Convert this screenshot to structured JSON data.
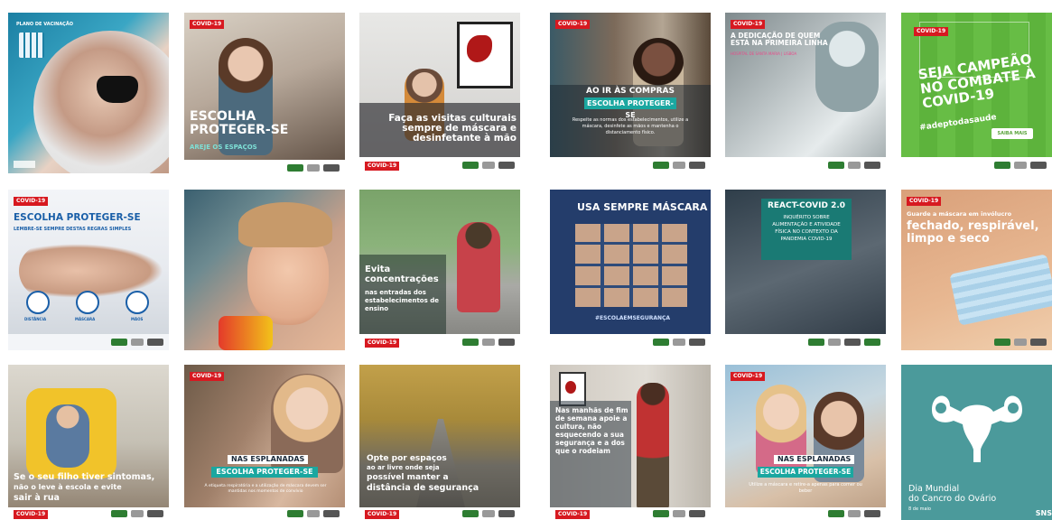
{
  "colors": {
    "covid_red": "#d71920",
    "teal": "#1aa7a0",
    "green_tile": "#6cc04a",
    "pink_text": "#e94b8a"
  },
  "tiles": {
    "t1": {
      "badge": "PLANO DE VACINAÇÃO"
    },
    "t2": {
      "badge": "COVID-19",
      "title": "ESCOLHA PROTEGER-SE",
      "subtitle": "AREJE OS ESPAÇOS"
    },
    "t3": {
      "title": "Faça as visitas culturais sempre de máscara e desinfetante à mão",
      "badge": "COVID-19"
    },
    "t4": {
      "badge": "COVID-19",
      "title": "AO IR ÀS COMPRAS",
      "banner": "ESCOLHA PROTEGER-SE",
      "body": "Respeite as normas dos estabelecimentos, utilize a máscara, desinfete as mãos e mantenha o distanciamento físico."
    },
    "t5": {
      "badge": "COVID-19",
      "title": "A DEDICAÇÃO DE QUEM ESTÁ NA PRIMEIRA LINHA",
      "subtitle": "HOSPITAL DE SANTA MARIA | LISBOA"
    },
    "t6": {
      "badge": "COVID-19",
      "title": "SEJA CAMPEÃO NO COMBATE À COVID-19",
      "hashtag": "#adeptodasaude",
      "button": "SAIBA MAIS"
    },
    "t7": {
      "badge": "COVID-19",
      "title": "ESCOLHA PROTEGER-SE",
      "subtitle": "LEMBRE-SE SEMPRE DESTAS REGRAS SIMPLES",
      "icon_labels": [
        "DISTÂNCIA",
        "MÁSCARA",
        "MÃOS"
      ]
    },
    "t8": {},
    "t9": {
      "title": "Evita concentrações",
      "body": "nas entradas dos estabelecimentos de ensino",
      "badge": "COVID-19"
    },
    "t10": {
      "title": "USA SEMPRE MÁSCARA",
      "hashtag": "#ESCOLAEMSEGURANÇA"
    },
    "t11": {
      "title": "REACT-COVID 2.0",
      "body": "INQUÉRITO SOBRE ALIMENTAÇÃO E ATIVIDADE FÍSICA NO CONTEXTO DA PANDEMIA COVID-19"
    },
    "t12": {
      "badge": "COVID-19",
      "title_small": "Guarde a máscara em invólucro",
      "title": "fechado, respirável, limpo e seco"
    },
    "t13": {
      "title_a": "Se o seu filho tiver sintomas,",
      "title_b": "não o leve à escola e evite",
      "title_c": "sair à rua",
      "badge": "COVID-19"
    },
    "t14": {
      "badge": "COVID-19",
      "title": "NAS ESPLANADAS",
      "banner": "ESCOLHA PROTEGER-SE",
      "body": "A etiqueta respiratória e a utilização de máscara devem ser mantidas nos momentos de convívio"
    },
    "t15": {
      "title_a": "Opte por espaços",
      "title_b": "ao ar livre onde seja",
      "title_c": "possível manter a",
      "title_d": "distância de segurança",
      "badge": "COVID-19"
    },
    "t16": {
      "title": "Nas manhãs de fim de semana apoie a cultura, não esquecendo a sua segurança e a dos que o rodeiam",
      "badge": "COVID-19"
    },
    "t17": {
      "badge": "COVID-19",
      "title": "NAS ESPLANADAS",
      "banner": "ESCOLHA PROTEGER-SE",
      "body": "Utilize a máscara e retire-a apenas para comer ou beber"
    },
    "t18": {
      "title_a": "Dia Mundial",
      "title_b": "do Cancro do Ovário",
      "date": "8 de maio",
      "brand": "SNS"
    }
  }
}
